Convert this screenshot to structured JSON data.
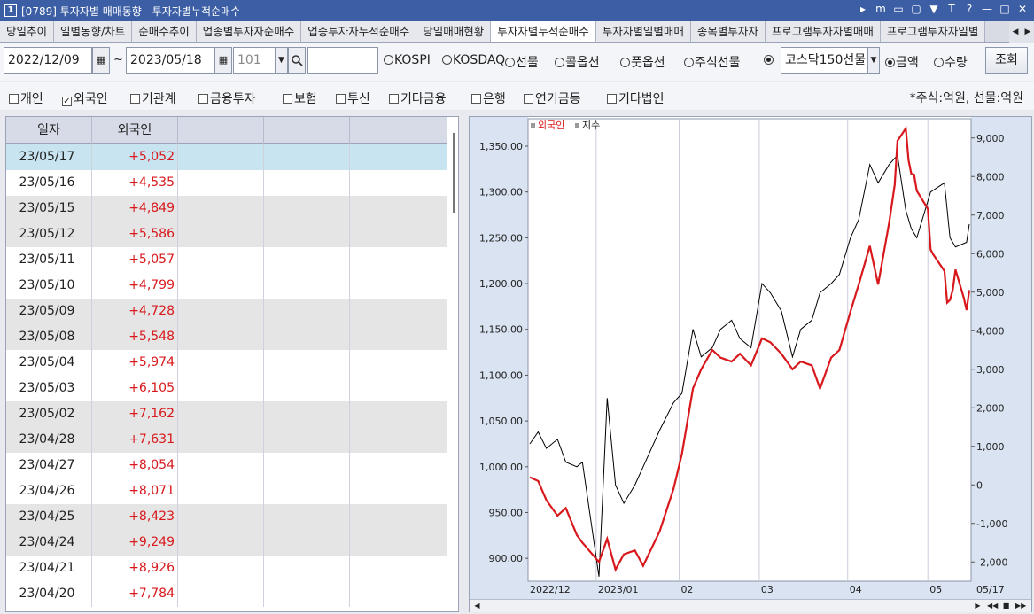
{
  "window": {
    "number": "1",
    "title": "[0789] 투자자별 매매동향 - 투자자별누적순매수",
    "controls": [
      "▸",
      "m",
      "▭",
      "▢",
      "▼",
      "T",
      "?",
      "—",
      "□",
      "✕"
    ]
  },
  "tabs": [
    {
      "label": "당일추이"
    },
    {
      "label": "일별동향/차트"
    },
    {
      "label": "순매수추이"
    },
    {
      "label": "업종별투자자순매수"
    },
    {
      "label": "업종투자자누적순매수"
    },
    {
      "label": "당일매매현황"
    },
    {
      "label": "투자자별누적순매수",
      "active": true
    },
    {
      "label": "투자자별일별매매"
    },
    {
      "label": "종목별투자자"
    },
    {
      "label": "프로그램투자자별매매"
    },
    {
      "label": "프로그램투자자일별"
    }
  ],
  "controls": {
    "start_date": "2022/12/09",
    "tilde": "~",
    "end_date": "2023/05/18",
    "code": "101",
    "code_search": "",
    "market_options": [
      {
        "label": "KOSPI",
        "selected": false
      },
      {
        "label": "KOSDAQ",
        "selected": false
      },
      {
        "label": "선물",
        "selected": false
      },
      {
        "label": "콜옵션",
        "selected": false
      },
      {
        "label": "풋옵션",
        "selected": false
      },
      {
        "label": "주식선물",
        "selected": false
      },
      {
        "label": "",
        "selected": true
      }
    ],
    "index_select": "코스닥150선물",
    "unit_options": [
      {
        "label": "금액",
        "selected": true
      },
      {
        "label": "수량",
        "selected": false
      }
    ],
    "search_button": "조회"
  },
  "investors": [
    {
      "label": "개인",
      "checked": false
    },
    {
      "label": "외국인",
      "checked": true
    },
    {
      "label": "기관계",
      "checked": false
    },
    {
      "label": "금융투자",
      "checked": false
    },
    {
      "label": "보험",
      "checked": false
    },
    {
      "label": "투신",
      "checked": false
    },
    {
      "label": "기타금융",
      "checked": false
    },
    {
      "label": "은행",
      "checked": false
    },
    {
      "label": "연기금등",
      "checked": false
    },
    {
      "label": "기타법인",
      "checked": false
    }
  ],
  "unit_note": "*주식:억원, 선물:억원",
  "table": {
    "headers": [
      "일자",
      "외국인",
      "",
      "",
      ""
    ],
    "rows": [
      {
        "date": "23/05/17",
        "value": "+5,052"
      },
      {
        "date": "23/05/16",
        "value": "+4,535"
      },
      {
        "date": "23/05/15",
        "value": "+4,849"
      },
      {
        "date": "23/05/12",
        "value": "+5,586"
      },
      {
        "date": "23/05/11",
        "value": "+5,057"
      },
      {
        "date": "23/05/10",
        "value": "+4,799"
      },
      {
        "date": "23/05/09",
        "value": "+4,728"
      },
      {
        "date": "23/05/08",
        "value": "+5,548"
      },
      {
        "date": "23/05/04",
        "value": "+5,974"
      },
      {
        "date": "23/05/03",
        "value": "+6,105"
      },
      {
        "date": "23/05/02",
        "value": "+7,162"
      },
      {
        "date": "23/04/28",
        "value": "+7,631"
      },
      {
        "date": "23/04/27",
        "value": "+8,054"
      },
      {
        "date": "23/04/26",
        "value": "+8,071"
      },
      {
        "date": "23/04/25",
        "value": "+8,423"
      },
      {
        "date": "23/04/24",
        "value": "+9,249"
      },
      {
        "date": "23/04/21",
        "value": "+8,926"
      },
      {
        "date": "23/04/20",
        "value": "+7,784"
      }
    ]
  },
  "chart_data": {
    "type": "line",
    "legend": [
      "외국인",
      "지수"
    ],
    "x_ticks": [
      "2022/12",
      "2023/01",
      "02",
      "03",
      "04",
      "05",
      "05/17"
    ],
    "y_left": {
      "ticks": [
        "1,350.00",
        "1,300.00",
        "1,250.00",
        "1,200.00",
        "1,150.00",
        "1,100.00",
        "1,050.00",
        "1,000.00",
        "950.00",
        "900.00"
      ],
      "range": [
        875,
        1380
      ]
    },
    "y_right": {
      "ticks": [
        "9,000",
        "8,000",
        "7,000",
        "6,000",
        "5,000",
        "4,000",
        "3,000",
        "2,000",
        "1,000",
        "0",
        "-1,000",
        "-2,000"
      ],
      "range": [
        -2500,
        9500
      ]
    },
    "series": [
      {
        "name": "지수",
        "axis": "left",
        "color": "#000000",
        "x": [
          "2022-12-09",
          "2022-12-12",
          "2022-12-15",
          "2022-12-19",
          "2022-12-22",
          "2022-12-26",
          "2022-12-28",
          "2023-01-03",
          "2023-01-06",
          "2023-01-09",
          "2023-01-12",
          "2023-01-16",
          "2023-01-19",
          "2023-01-25",
          "2023-01-30",
          "2023-02-02",
          "2023-02-06",
          "2023-02-09",
          "2023-02-13",
          "2023-02-16",
          "2023-02-20",
          "2023-02-23",
          "2023-02-27",
          "2023-03-03",
          "2023-03-06",
          "2023-03-10",
          "2023-03-14",
          "2023-03-17",
          "2023-03-21",
          "2023-03-24",
          "2023-03-28",
          "2023-03-31",
          "2023-04-04",
          "2023-04-07",
          "2023-04-11",
          "2023-04-14",
          "2023-04-18",
          "2023-04-21",
          "2023-04-24",
          "2023-04-26",
          "2023-04-28",
          "2023-05-03",
          "2023-05-08",
          "2023-05-10",
          "2023-05-12",
          "2023-05-16",
          "2023-05-17"
        ],
        "values": [
          1025,
          1038,
          1020,
          1030,
          1005,
          1000,
          1005,
          880,
          1075,
          980,
          960,
          980,
          1000,
          1040,
          1070,
          1080,
          1150,
          1120,
          1130,
          1150,
          1160,
          1140,
          1130,
          1200,
          1190,
          1170,
          1120,
          1150,
          1160,
          1190,
          1200,
          1210,
          1250,
          1270,
          1330,
          1310,
          1330,
          1340,
          1280,
          1260,
          1250,
          1300,
          1310,
          1250,
          1240,
          1245,
          1265
        ]
      },
      {
        "name": "외국인",
        "axis": "right",
        "color": "#d8181c",
        "x": [
          "2022-12-09",
          "2022-12-12",
          "2022-12-15",
          "2022-12-19",
          "2022-12-22",
          "2022-12-26",
          "2022-12-28",
          "2023-01-03",
          "2023-01-06",
          "2023-01-09",
          "2023-01-12",
          "2023-01-16",
          "2023-01-19",
          "2023-01-25",
          "2023-01-30",
          "2023-02-02",
          "2023-02-06",
          "2023-02-09",
          "2023-02-13",
          "2023-02-16",
          "2023-02-20",
          "2023-02-23",
          "2023-02-27",
          "2023-03-03",
          "2023-03-06",
          "2023-03-10",
          "2023-03-14",
          "2023-03-17",
          "2023-03-21",
          "2023-03-24",
          "2023-03-28",
          "2023-03-31",
          "2023-04-04",
          "2023-04-07",
          "2023-04-11",
          "2023-04-14",
          "2023-04-18",
          "2023-04-20",
          "2023-04-21",
          "2023-04-24",
          "2023-04-25",
          "2023-04-26",
          "2023-04-27",
          "2023-04-28",
          "2023-05-02",
          "2023-05-03",
          "2023-05-04",
          "2023-05-08",
          "2023-05-09",
          "2023-05-10",
          "2023-05-11",
          "2023-05-12",
          "2023-05-15",
          "2023-05-16",
          "2023-05-17"
        ],
        "values": [
          200,
          100,
          -400,
          -800,
          -600,
          -1300,
          -1500,
          -2000,
          -1400,
          -2200,
          -1800,
          -1700,
          -2100,
          -1200,
          -100,
          800,
          2500,
          3000,
          3500,
          3300,
          3200,
          3400,
          3100,
          3800,
          3700,
          3400,
          3000,
          3200,
          3100,
          2500,
          3300,
          3500,
          4500,
          5200,
          6200,
          5200,
          6800,
          7784,
          8926,
          9249,
          8423,
          8071,
          8054,
          7631,
          7162,
          6105,
          5974,
          5548,
          4728,
          4799,
          5057,
          5586,
          4849,
          4535,
          5052
        ]
      }
    ]
  }
}
